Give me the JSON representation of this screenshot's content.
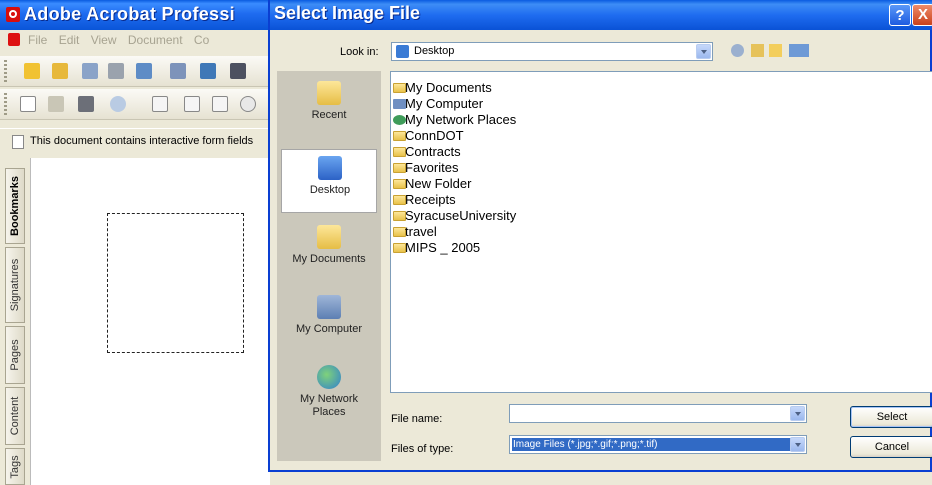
{
  "acrobat": {
    "title": "Adobe Acrobat Professi",
    "menu": [
      "File",
      "Edit",
      "View",
      "Document",
      "Co"
    ],
    "notice": "This document contains interactive form fields",
    "nav_tabs": [
      "Bookmarks",
      "Signatures",
      "Pages",
      "Content",
      "Tags"
    ]
  },
  "dialog": {
    "title": "Select Image File",
    "look_in_label": "Look in:",
    "look_in_value": "Desktop",
    "places": [
      "Recent",
      "Desktop",
      "My Documents",
      "My Computer",
      "My Network Places"
    ],
    "files": [
      "My Documents",
      "My Computer",
      "My Network Places",
      "ConnDOT",
      "Contracts",
      "Favorites",
      "New Folder",
      "Receipts",
      "SyracuseUniversity",
      "travel",
      "MIPS _ 2005"
    ],
    "file_name_label": "File name:",
    "file_name_value": "",
    "files_of_type_label": "Files of type:",
    "files_of_type_value": "Image Files (*.jpg;*.gif;*.png;*.tif)",
    "select_button": "Select",
    "cancel_button": "Cancel",
    "help_button": "?",
    "close_button": "X"
  },
  "colors": {
    "titlebar": "#0a5be0",
    "selection": "#316ac5",
    "dialog_bg": "#ece9d8"
  }
}
